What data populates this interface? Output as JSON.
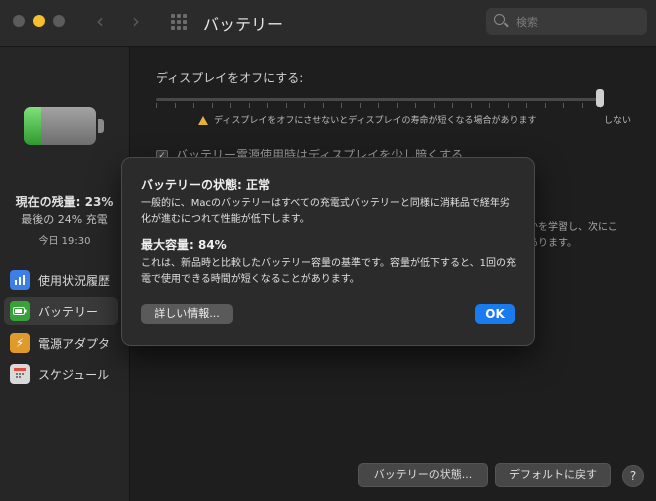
{
  "window": {
    "title": "バッテリー",
    "search_placeholder": "検索"
  },
  "sidebar": {
    "battery_level_percent": 23,
    "charge_current": "現在の残量: 23%",
    "charge_last": "最後の 24% 充電",
    "charge_time": "今日 19:30",
    "items": [
      {
        "label": "使用状況履歴",
        "icon": "bar-chart-icon",
        "color": "#3d7ee8",
        "selected": false
      },
      {
        "label": "バッテリー",
        "icon": "battery-icon",
        "color": "#35a33a",
        "selected": true
      },
      {
        "label": "電源アダプタ",
        "icon": "lightning-icon",
        "color": "#e09a2c",
        "selected": false
      },
      {
        "label": "スケジュール",
        "icon": "calendar-icon",
        "color": "#d9d9d9",
        "selected": false
      }
    ]
  },
  "main": {
    "display_off_label": "ディスプレイをオフにする:",
    "warning_text": "ディスプレイをオフにさせないとディスプレイの寿命が短くなる場合があります",
    "never_label": "しない",
    "checkbox_label": "バッテリー電源使用時はディスプレイを少し暗くする",
    "learn_line1": "るかを学習し、次にこ",
    "learn_line2": "があります。",
    "battery_status_button": "バッテリーの状態...",
    "restore_defaults_button": "デフォルトに戻す",
    "help_button": "?"
  },
  "dialog": {
    "title": "バッテリーの状態: 正常",
    "body1": "一般的に、Macのバッテリーはすべての充電式バッテリーと同様に消耗品で経年劣化が進むにつれて性能が低下します。",
    "max_capacity": "最大容量: 84%",
    "body2": "これは、新品時と比較したバッテリー容量の基準です。容量が低下すると、1回の充電で使用できる時間が短くなることがあります。",
    "details_button": "詳しい情報...",
    "ok_button": "OK"
  },
  "colors": {
    "accent": "#1a7bef",
    "battery_green": "#35a33a",
    "warning": "#e2b23c"
  }
}
